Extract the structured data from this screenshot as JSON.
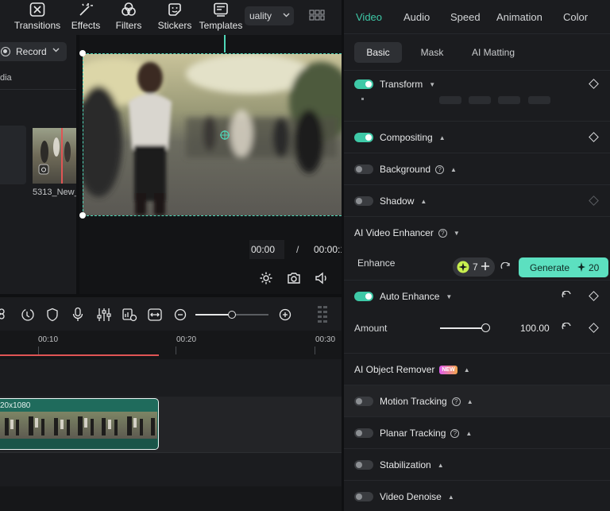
{
  "toolbar": {
    "items": [
      {
        "label": "Transitions",
        "icon": "transitions-icon"
      },
      {
        "label": "Effects",
        "icon": "effects-icon"
      },
      {
        "label": "Filters",
        "icon": "filters-icon"
      },
      {
        "label": "Stickers",
        "icon": "stickers-icon"
      },
      {
        "label": "Templates",
        "icon": "templates-icon"
      }
    ],
    "quality_label": "uality"
  },
  "media": {
    "record_label": "Record",
    "section_label": "dia",
    "thumb_caption": "5313_New_"
  },
  "player": {
    "current_time": "00:00",
    "separator": "/",
    "total_time": "00:00:1"
  },
  "timeline": {
    "ticks": [
      "00:10",
      "00:20",
      "00:30"
    ],
    "clip_label": "20x1080",
    "zoom_level": 0.5
  },
  "panel": {
    "tabs": [
      "Video",
      "Audio",
      "Speed",
      "Animation",
      "Color"
    ],
    "active_tab": "Video",
    "subtabs": [
      "Basic",
      "Mask",
      "AI Matting"
    ],
    "active_subtab": "Basic",
    "transform_label": "Transform",
    "compositing_label": "Compositing",
    "background_label": "Background",
    "shadow_label": "Shadow",
    "ai_enhancer_label": "AI Video Enhancer",
    "enhance_label": "Enhance",
    "credits_value": "7",
    "generate_label": "Generate",
    "generate_cost": "20",
    "auto_enhance_label": "Auto Enhance",
    "amount_label": "Amount",
    "amount_value": "100.00",
    "amount_fraction": 1.0,
    "object_remover_label": "AI Object Remover",
    "new_badge": "NEW",
    "motion_tracking_label": "Motion Tracking",
    "planar_tracking_label": "Planar Tracking",
    "stabilization_label": "Stabilization",
    "video_denoise_label": "Video Denoise"
  },
  "colors": {
    "accent": "#3ec9a7",
    "selection": "#4fd7b8",
    "playhead": "#e05555",
    "clip": "#1f6b5c"
  }
}
